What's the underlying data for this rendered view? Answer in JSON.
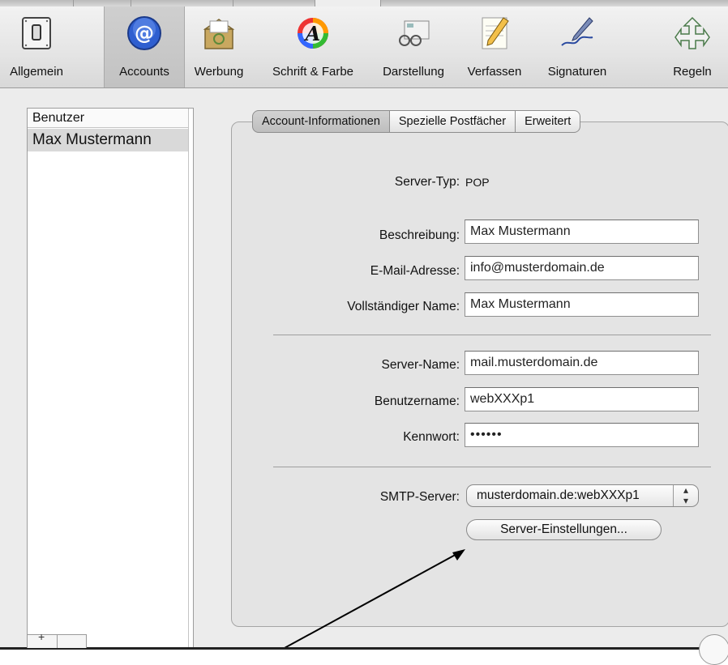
{
  "colors": {
    "toolbar_bg": "#e4e4e4",
    "selected_tab": "#c8c8c8",
    "window_bg": "#ececec",
    "list_selection": "#d9d9d9"
  },
  "toolbar": {
    "items": [
      {
        "label": "Allgemein",
        "icon": "switch-icon"
      },
      {
        "label": "Accounts",
        "icon": "at-sign-icon"
      },
      {
        "label": "Werbung",
        "icon": "junk-mail-icon"
      },
      {
        "label": "Schrift & Farbe",
        "icon": "font-color-icon"
      },
      {
        "label": "Darstellung",
        "icon": "viewing-icon"
      },
      {
        "label": "Verfassen",
        "icon": "compose-pencil-icon"
      },
      {
        "label": "Signaturen",
        "icon": "signature-pen-icon"
      },
      {
        "label": "Regeln",
        "icon": "rules-arrows-icon"
      }
    ],
    "selected": "Accounts"
  },
  "account_list": {
    "header": "Benutzer",
    "items": [
      "Max Mustermann"
    ]
  },
  "tabs": [
    "Account-Informationen",
    "Spezielle Postfächer",
    "Erweitert"
  ],
  "account_info": {
    "server_type_label": "Server-Typ:",
    "server_type_value": "POP",
    "description_label": "Beschreibung:",
    "description_value": "Max Mustermann",
    "email_label": "E-Mail-Adresse:",
    "email_value": "info@musterdomain.de",
    "full_name_label": "Vollständiger Name:",
    "full_name_value": "Max Mustermann",
    "server_name_label": "Server-Name:",
    "server_name_value": "mail.musterdomain.de",
    "username_label": "Benutzername:",
    "username_value": "webXXXp1",
    "password_label": "Kennwort:",
    "password_value": "••••••",
    "smtp_label": "SMTP-Server:",
    "smtp_value": "musterdomain.de:webXXXp1",
    "server_settings_button": "Server-Einstellungen..."
  }
}
